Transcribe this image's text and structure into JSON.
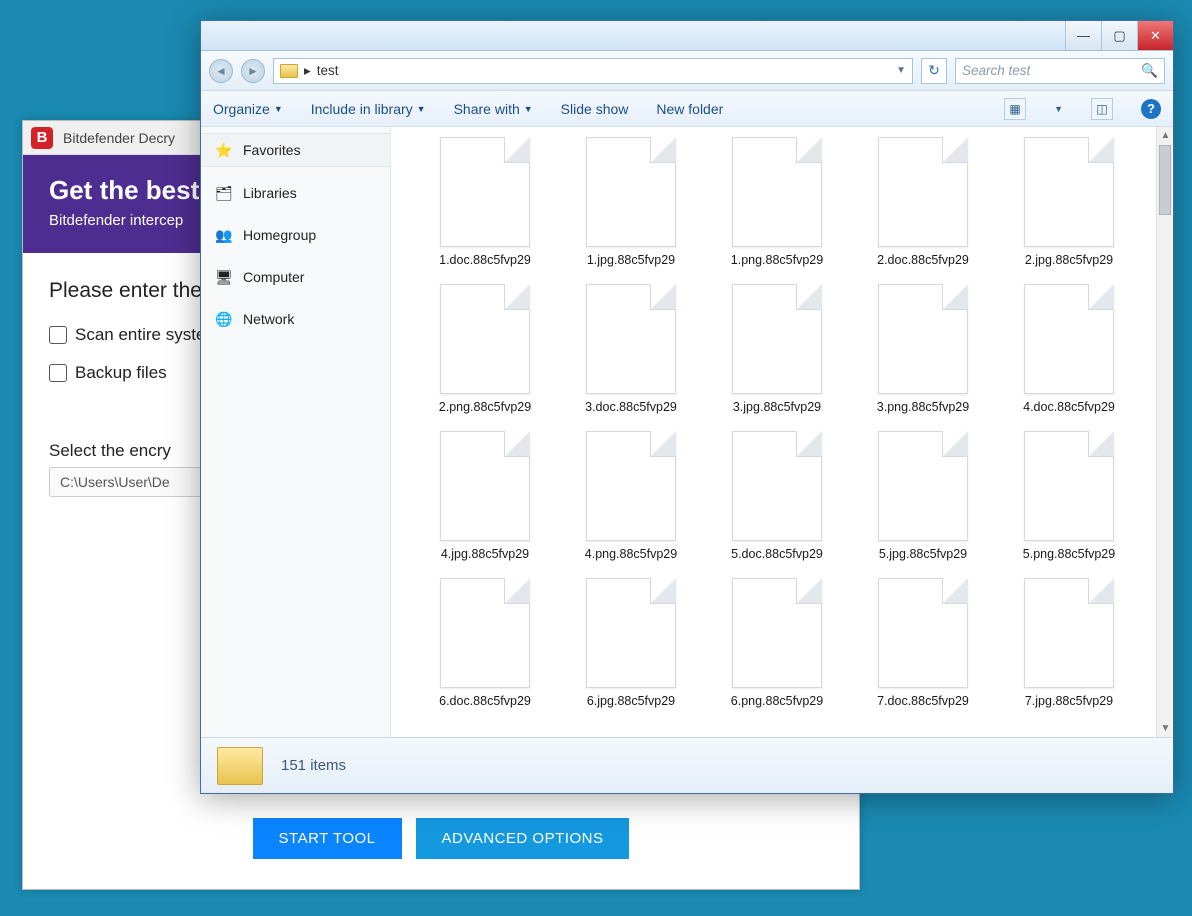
{
  "bitdefender": {
    "title": "Bitdefender Decry",
    "hero_title": "Get the best",
    "hero_sub": "Bitdefender intercep",
    "prompt": "Please enter the",
    "check1": "Scan entire syste",
    "check2": "Backup files",
    "select_label": "Select the encry",
    "path": "C:\\Users\\User\\De",
    "btn_start": "START TOOL",
    "btn_adv": "ADVANCED OPTIONS"
  },
  "explorer": {
    "breadcrumb_sep": "▸",
    "breadcrumb": "test",
    "search_placeholder": "Search test",
    "toolbar": {
      "organize": "Organize",
      "include": "Include in library",
      "share": "Share with",
      "slideshow": "Slide show",
      "newfolder": "New folder"
    },
    "side": {
      "favorites": "Favorites",
      "libraries": "Libraries",
      "homegroup": "Homegroup",
      "computer": "Computer",
      "network": "Network"
    },
    "files": [
      "1.doc.88c5fvp29",
      "1.jpg.88c5fvp29",
      "1.png.88c5fvp29",
      "2.doc.88c5fvp29",
      "2.jpg.88c5fvp29",
      "2.png.88c5fvp29",
      "3.doc.88c5fvp29",
      "3.jpg.88c5fvp29",
      "3.png.88c5fvp29",
      "4.doc.88c5fvp29",
      "4.jpg.88c5fvp29",
      "4.png.88c5fvp29",
      "5.doc.88c5fvp29",
      "5.jpg.88c5fvp29",
      "5.png.88c5fvp29",
      "6.doc.88c5fvp29",
      "6.jpg.88c5fvp29",
      "6.png.88c5fvp29",
      "7.doc.88c5fvp29",
      "7.jpg.88c5fvp29"
    ],
    "status": "151 items"
  }
}
